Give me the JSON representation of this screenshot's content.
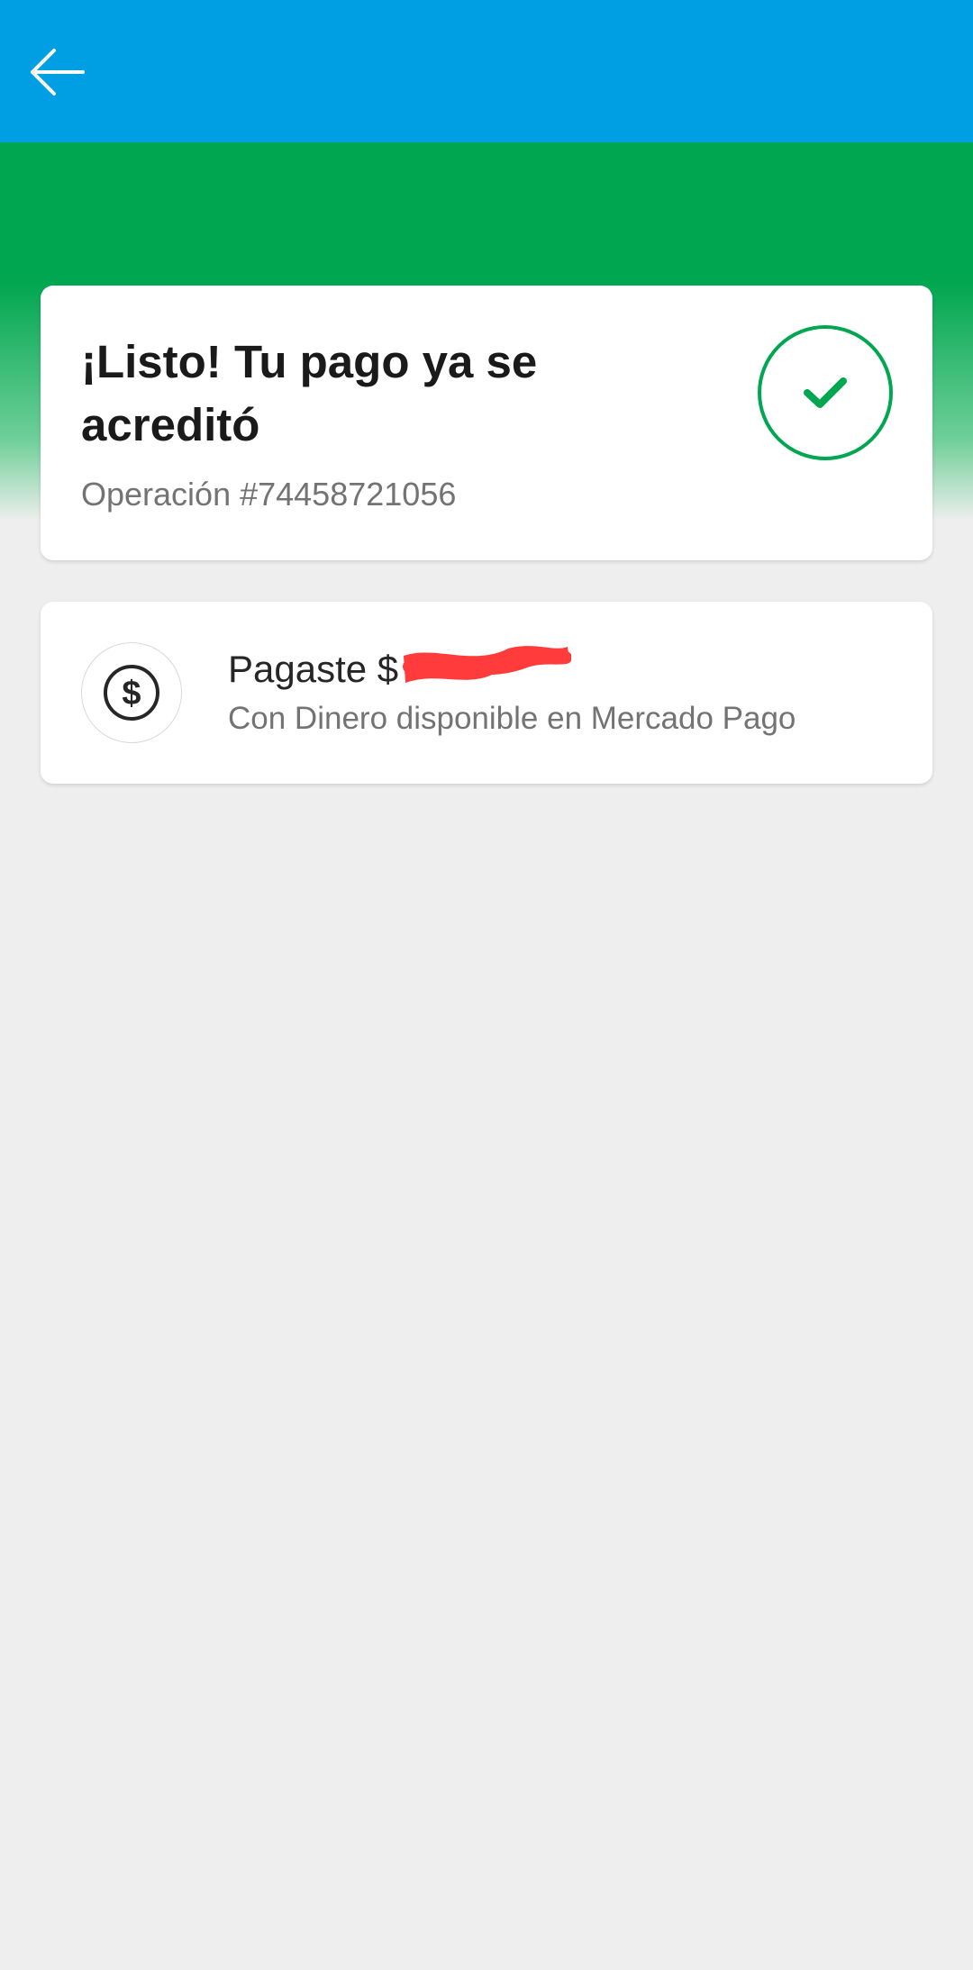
{
  "header": {
    "back_icon": "arrow-left-icon",
    "color": "#009ee3"
  },
  "hero": {
    "color": "#00a650"
  },
  "status_card": {
    "title": "¡Listo! Tu pago ya se acreditó",
    "operation": "Operación #74458721056",
    "icon": "check-circle-icon",
    "icon_color": "#00a650"
  },
  "payment_card": {
    "icon": "dollar-coin-icon",
    "title_prefix": "Pagaste $",
    "amount_redacted": true,
    "redaction_color": "#ff3b3b",
    "subtitle": "Con Dinero disponible en Mercado Pago"
  }
}
